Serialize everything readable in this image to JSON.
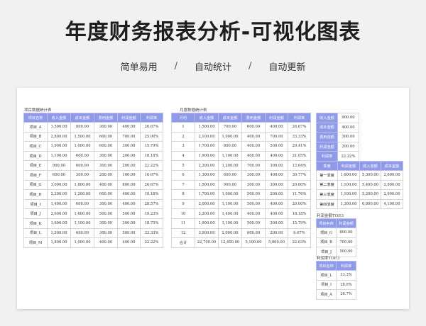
{
  "header": {
    "title": "年度财务报表分析-可视化图表",
    "tags": [
      "简单易用",
      "自动统计",
      "自动更新"
    ],
    "separator": "/"
  },
  "colors": {
    "header_fill": "#8f9ae8",
    "background": "#f1f1f1"
  },
  "project_table": {
    "caption": "项目数据统计表",
    "columns": [
      "项目名称",
      "收入金额",
      "成本金额",
      "费用金额",
      "利润金额",
      "利润率"
    ],
    "rows": [
      [
        "项目_A",
        "1,500.00",
        "800.00",
        "300.00",
        "400.00",
        "26.67%"
      ],
      [
        "项目_B",
        "2,800.00",
        "1,500.00",
        "600.00",
        "700.00",
        "25.00%"
      ],
      [
        "项目_C",
        "1,900.00",
        "1,000.00",
        "600.00",
        "300.00",
        "15.79%"
      ],
      [
        "项目_D",
        "1,100.00",
        "600.00",
        "300.00",
        "200.00",
        "18.18%"
      ],
      [
        "项目_E",
        "900.00",
        "600.00",
        "300.00",
        "200.00",
        "22.22%"
      ],
      [
        "项目_F",
        "600.00",
        "300.00",
        "200.00",
        "100.00",
        "16.67%"
      ],
      [
        "项目_G",
        "3,000.00",
        "1,800.00",
        "400.00",
        "800.00",
        "26.67%"
      ],
      [
        "项目_H",
        "2,200.00",
        "1,200.00",
        "600.00",
        "400.00",
        "18.18%"
      ],
      [
        "项目_I",
        "1,400.00",
        "600.00",
        "300.00",
        "400.00",
        "28.57%"
      ],
      [
        "项目_J",
        "2,600.00",
        "1,600.00",
        "500.00",
        "500.00",
        "19.23%"
      ],
      [
        "项目_K",
        "1,600.00",
        "1,100.00",
        "300.00",
        "300.00",
        "18.75%"
      ],
      [
        "项目_L",
        "1,500.00",
        "600.00",
        "300.00",
        "500.00",
        "33.33%"
      ],
      [
        "项目_M",
        "1,800.00",
        "1,000.00",
        "400.00",
        "400.00",
        "22.22%"
      ]
    ]
  },
  "monthly_table": {
    "caption": "月度数据统计表",
    "columns": [
      "月份",
      "收入金额",
      "成本金额",
      "费用金额",
      "利润金额",
      "利润率"
    ],
    "rows": [
      [
        "1",
        "1,500.00",
        "700.00",
        "600.00",
        "400.00",
        "26.67%"
      ],
      [
        "2",
        "2,100.00",
        "1,000.00",
        "400.00",
        "700.00",
        "33.33%"
      ],
      [
        "3",
        "1,700.00",
        "800.00",
        "400.00",
        "500.00",
        "29.41%"
      ],
      [
        "4",
        "1,900.00",
        "1,100.00",
        "400.00",
        "400.00",
        "21.05%"
      ],
      [
        "5",
        "2,200.00",
        "1,200.00",
        "700.00",
        "300.00",
        "13.64%"
      ],
      [
        "6",
        "1,300.00",
        "600.00",
        "300.00",
        "400.00",
        "30.77%"
      ],
      [
        "7",
        "1,500.00",
        "900.00",
        "300.00",
        "300.00",
        "20.00%"
      ],
      [
        "8",
        "1,700.00",
        "1,000.00",
        "500.00",
        "200.00",
        "11.76%"
      ],
      [
        "9",
        "2,000.00",
        "1,100.00",
        "500.00",
        "400.00",
        "20.00%"
      ],
      [
        "10",
        "2,200.00",
        "1,400.00",
        "400.00",
        "400.00",
        "18.18%"
      ],
      [
        "11",
        "1,900.00",
        "1,100.00",
        "500.00",
        "300.00",
        "15.79%"
      ],
      [
        "12",
        "3,000.00",
        "2,000.00",
        "800.00",
        "200.00",
        "6.67%"
      ],
      [
        "合计",
        "22,700.00",
        "12,400.00",
        "5,100.00",
        "5,000.00",
        "22.03%"
      ]
    ]
  },
  "summary_table": {
    "rows": [
      [
        "收入金额",
        "900.00"
      ],
      [
        "成本金额",
        "400.00"
      ],
      [
        "费用金额",
        "300.00"
      ],
      [
        "利润金额",
        "200.00"
      ],
      [
        "利润率",
        "22.22%"
      ]
    ]
  },
  "quarter_table": {
    "columns": [
      "季度",
      "利润金额",
      "收入金额",
      "成本金额"
    ],
    "rows": [
      [
        "第一季度",
        "1,600.00",
        "5,300.00",
        "2,600.00"
      ],
      [
        "第二季度",
        "1,100.00",
        "5,400.00",
        "2,900.00"
      ],
      [
        "第三季度",
        "1,100.00",
        "5,200.00",
        "2,900.00"
      ],
      [
        "第四季度",
        "1,300.00",
        "6,800.00",
        "4,100.00"
      ]
    ]
  },
  "profit_amount_top": {
    "caption": "利润金额TOP.3",
    "columns": [
      "项目名称",
      "利润金额"
    ],
    "rows": [
      [
        "项目_G",
        "800.00"
      ],
      [
        "项目_B",
        "700.00"
      ],
      [
        "项目_J",
        "500.00"
      ]
    ]
  },
  "profit_rate_top": {
    "caption": "利润率TOP.3",
    "columns": [
      "项目名称",
      "利润率"
    ],
    "rows": [
      [
        "项目_L",
        "33.3%"
      ],
      [
        "项目_I",
        "28.6%"
      ],
      [
        "项目_A",
        "26.7%"
      ]
    ]
  }
}
